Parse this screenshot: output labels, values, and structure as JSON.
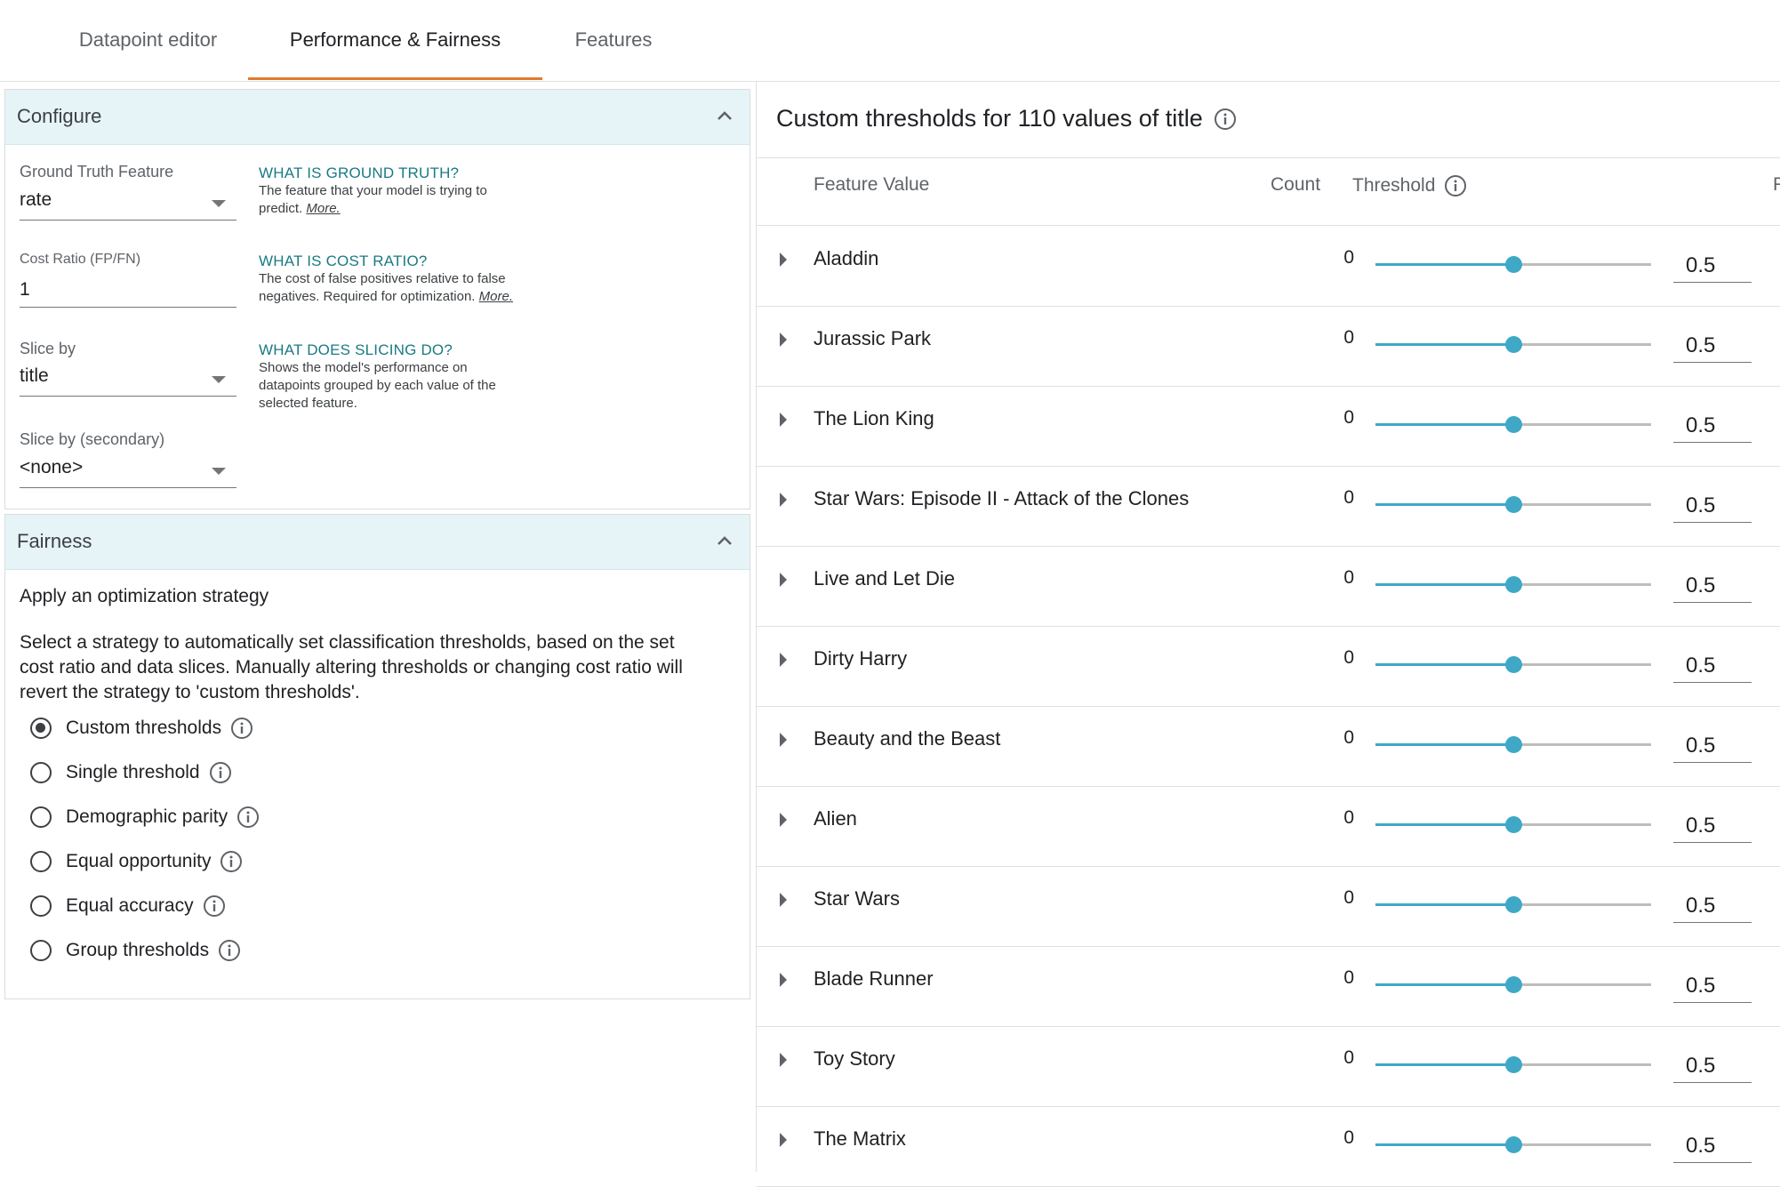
{
  "tabs": [
    {
      "label": "Datapoint editor"
    },
    {
      "label": "Performance & Fairness"
    },
    {
      "label": "Features"
    }
  ],
  "active_tab": "Performance & Fairness",
  "accent_color": "#e07a2e",
  "slider_color": "#3fa8c6",
  "configure": {
    "title": "Configure",
    "ground_truth_label": "Ground Truth Feature",
    "ground_truth_value": "rate",
    "ground_truth_help_title": "WHAT IS GROUND TRUTH?",
    "ground_truth_help_body": "The feature that your model is trying to predict.",
    "cost_ratio_label": "Cost Ratio (FP/FN)",
    "cost_ratio_value": "1",
    "cost_ratio_help_title": "WHAT IS COST RATIO?",
    "cost_ratio_help_body": "The cost of false positives relative to false negatives. Required for optimization.",
    "slice_label": "Slice by",
    "slice_value": "title",
    "slice_help_title": "WHAT DOES SLICING DO?",
    "slice_help_body": "Shows the model's performance on datapoints grouped by each value of the selected feature.",
    "slice2_label": "Slice by (secondary)",
    "slice2_value": "<none>",
    "more_link": "More."
  },
  "fairness": {
    "title": "Fairness",
    "heading": "Apply an optimization strategy",
    "description": "Select a strategy to automatically set classification thresholds, based on the set cost ratio and data slices. Manually altering thresholds or changing cost ratio will revert the strategy to 'custom thresholds'.",
    "options": [
      {
        "label": "Custom thresholds",
        "selected": true
      },
      {
        "label": "Single threshold",
        "selected": false
      },
      {
        "label": "Demographic parity",
        "selected": false
      },
      {
        "label": "Equal opportunity",
        "selected": false
      },
      {
        "label": "Equal accuracy",
        "selected": false
      },
      {
        "label": "Group thresholds",
        "selected": false
      }
    ]
  },
  "thresholds": {
    "title": "Custom thresholds for 110 values of title",
    "col_feature": "Feature Value",
    "col_count": "Count",
    "col_threshold": "Threshold",
    "col_peek": "F",
    "rows": [
      {
        "name": "Aladdin",
        "count": "0",
        "threshold": "0.5",
        "level": 0.5
      },
      {
        "name": "Jurassic Park",
        "count": "0",
        "threshold": "0.5",
        "level": 0.5
      },
      {
        "name": "The Lion King",
        "count": "0",
        "threshold": "0.5",
        "level": 0.5
      },
      {
        "name": "Star Wars: Episode II - Attack of the Clones",
        "count": "0",
        "threshold": "0.5",
        "level": 0.5
      },
      {
        "name": "Live and Let Die",
        "count": "0",
        "threshold": "0.5",
        "level": 0.5
      },
      {
        "name": "Dirty Harry",
        "count": "0",
        "threshold": "0.5",
        "level": 0.5
      },
      {
        "name": "Beauty and the Beast",
        "count": "0",
        "threshold": "0.5",
        "level": 0.5
      },
      {
        "name": "Alien",
        "count": "0",
        "threshold": "0.5",
        "level": 0.5
      },
      {
        "name": "Star Wars",
        "count": "0",
        "threshold": "0.5",
        "level": 0.5
      },
      {
        "name": "Blade Runner",
        "count": "0",
        "threshold": "0.5",
        "level": 0.5
      },
      {
        "name": "Toy Story",
        "count": "0",
        "threshold": "0.5",
        "level": 0.5
      },
      {
        "name": "The Matrix",
        "count": "0",
        "threshold": "0.5",
        "level": 0.5
      }
    ]
  }
}
